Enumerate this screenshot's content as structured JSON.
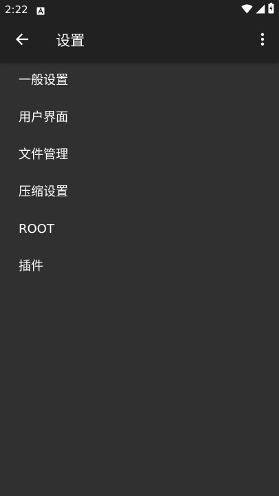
{
  "status_bar": {
    "time": "2:22",
    "icons": [
      "notification-a-icon",
      "wifi-icon",
      "signal-icon",
      "battery-charging-icon"
    ]
  },
  "toolbar": {
    "title": "设置",
    "back_icon": "arrow-back-icon",
    "overflow_icon": "more-vert-icon"
  },
  "settings": {
    "items": [
      {
        "label": "一般设置"
      },
      {
        "label": "用户界面"
      },
      {
        "label": "文件管理"
      },
      {
        "label": "压缩设置"
      },
      {
        "label": "ROOT"
      },
      {
        "label": "插件"
      }
    ]
  },
  "colors": {
    "background": "#303030",
    "toolbar": "#212121",
    "text": "#ffffff"
  }
}
